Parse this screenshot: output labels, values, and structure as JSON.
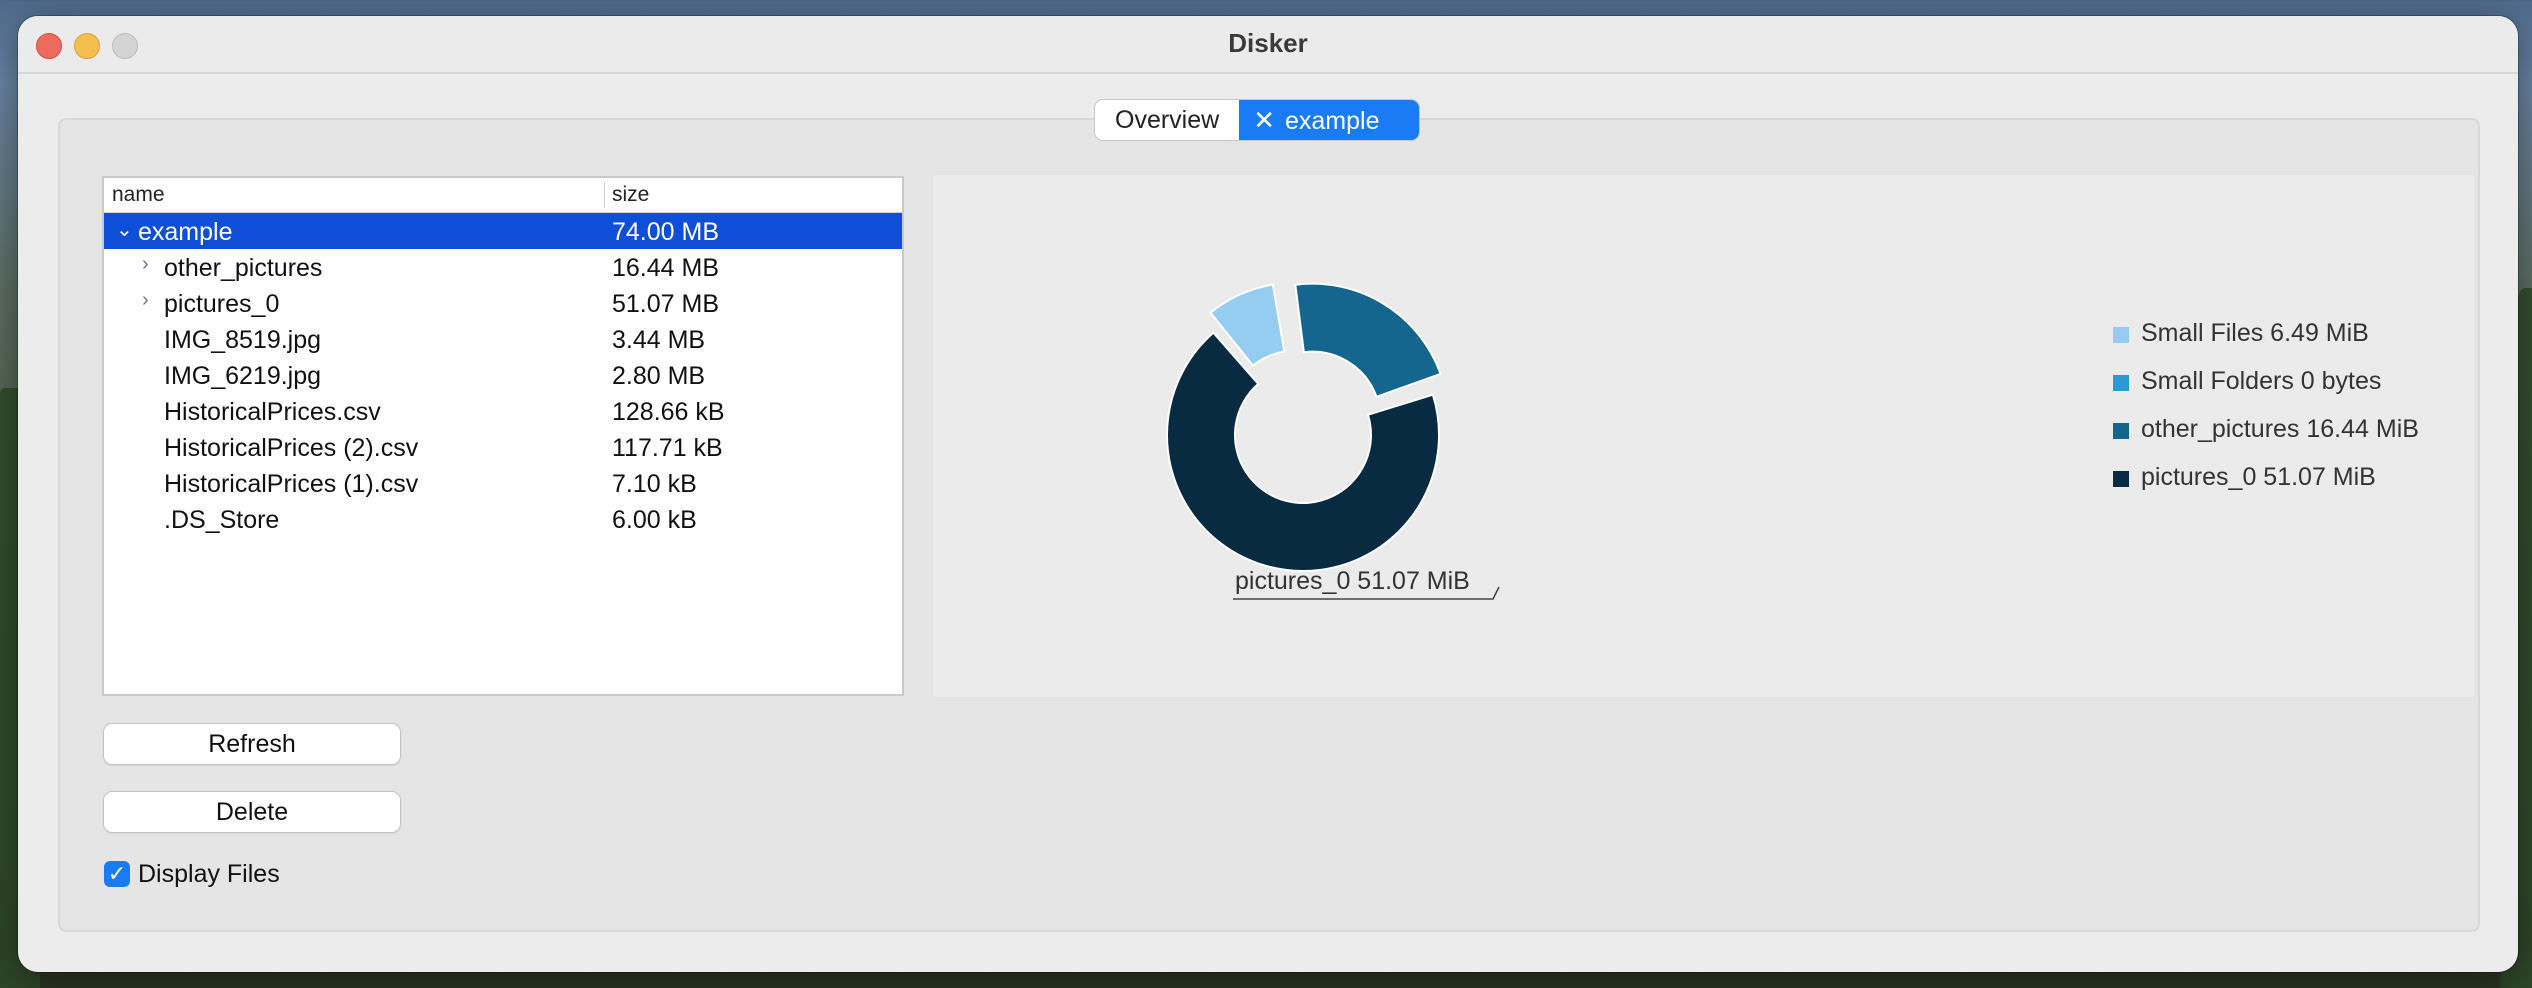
{
  "window": {
    "title": "Disker"
  },
  "tabs": [
    {
      "label": "Overview"
    },
    {
      "label": "example",
      "close_icon": "close-icon"
    }
  ],
  "tree": {
    "columns": [
      "name",
      "size"
    ],
    "rows": [
      {
        "name": "example",
        "size": "74.00 MB",
        "expanded": true,
        "level": 0,
        "selected": true
      },
      {
        "name": "other_pictures",
        "size": "16.44 MB",
        "expandable": true,
        "level": 1
      },
      {
        "name": "pictures_0",
        "size": "51.07 MB",
        "expandable": true,
        "level": 1
      },
      {
        "name": "IMG_8519.jpg",
        "size": "3.44 MB",
        "level": 1
      },
      {
        "name": "IMG_6219.jpg",
        "size": "2.80 MB",
        "level": 1
      },
      {
        "name": "HistoricalPrices.csv",
        "size": "128.66 kB",
        "level": 1
      },
      {
        "name": "HistoricalPrices (2).csv",
        "size": "117.71 kB",
        "level": 1
      },
      {
        "name": "HistoricalPrices (1).csv",
        "size": "7.10 kB",
        "level": 1
      },
      {
        "name": ".DS_Store",
        "size": "6.00 kB",
        "level": 1
      }
    ]
  },
  "buttons": {
    "refresh": "Refresh",
    "delete": "Delete"
  },
  "display_files": {
    "label": "Display Files",
    "checked": true
  },
  "chart_data": {
    "type": "pie",
    "donut": true,
    "legend_position": "right",
    "slices": [
      {
        "label": "Small Files 6.49 MiB",
        "name": "Small Files",
        "value": 6.49,
        "unit": "MiB",
        "color": "#94cdef",
        "exploded": true
      },
      {
        "label": "Small Folders 0 bytes",
        "name": "Small Folders",
        "value": 0,
        "unit": "bytes",
        "color": "#2a9ad6",
        "exploded": false
      },
      {
        "label": "other_pictures 16.44 MiB",
        "name": "other_pictures",
        "value": 16.44,
        "unit": "MiB",
        "color": "#15668f",
        "exploded": true
      },
      {
        "label": "pictures_0 51.07 MiB",
        "name": "pictures_0",
        "value": 51.07,
        "unit": "MiB",
        "color": "#082b42",
        "exploded": false
      }
    ],
    "callout": "pictures_0 51.07 MiB"
  }
}
